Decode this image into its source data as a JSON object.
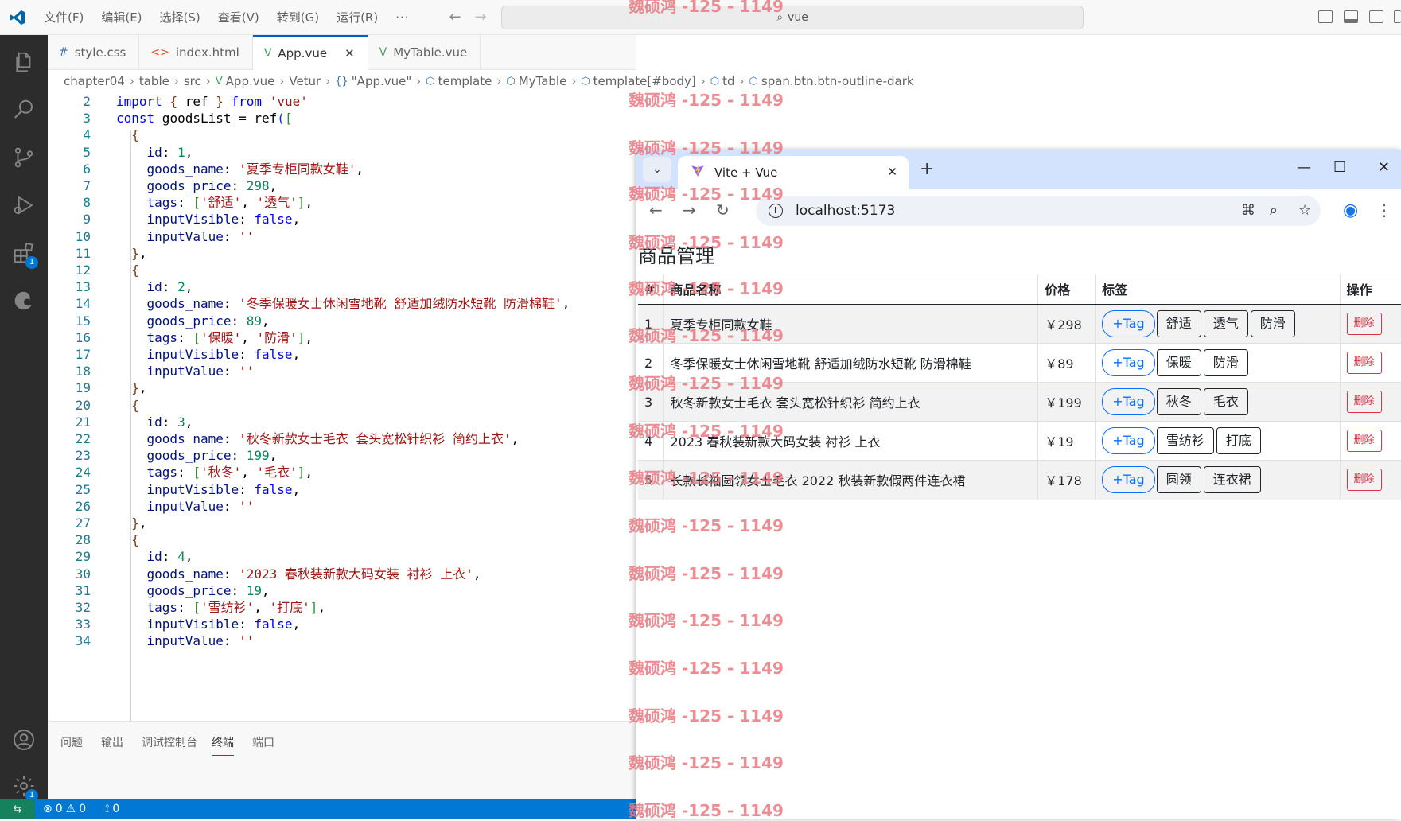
{
  "vscode": {
    "menu": [
      "文件(F)",
      "编辑(E)",
      "选择(S)",
      "查看(V)",
      "转到(G)",
      "运行(R)",
      "···"
    ],
    "search_text": "vue",
    "tabs": [
      {
        "icon": "#",
        "label": "style.css"
      },
      {
        "icon": "<>",
        "label": "index.html"
      },
      {
        "icon": "V",
        "label": "App.vue",
        "active": true
      },
      {
        "icon": "V",
        "label": "MyTable.vue"
      }
    ],
    "breadcrumb": [
      "chapter04",
      "table",
      "src",
      "App.vue",
      "Vetur",
      "\"App.vue\"",
      "template",
      "MyTable",
      "template[#body]",
      "td",
      "span.btn.btn-outline-dark"
    ],
    "code_lines": [
      {
        "n": "2",
        "t": "import { ref } from 'vue'"
      },
      {
        "n": "3",
        "t": "const goodsList = ref(["
      },
      {
        "n": "4",
        "t": "  {"
      },
      {
        "n": "5",
        "t": "    id: 1,"
      },
      {
        "n": "6",
        "t": "    goods_name: '夏季专柜同款女鞋',"
      },
      {
        "n": "7",
        "t": "    goods_price: 298,"
      },
      {
        "n": "8",
        "t": "    tags: ['舒适', '透气'],"
      },
      {
        "n": "9",
        "t": "    inputVisible: false,"
      },
      {
        "n": "10",
        "t": "    inputValue: ''"
      },
      {
        "n": "11",
        "t": "  },"
      },
      {
        "n": "12",
        "t": "  {"
      },
      {
        "n": "13",
        "t": "    id: 2,"
      },
      {
        "n": "14",
        "t": "    goods_name: '冬季保暖女士休闲雪地靴 舒适加绒防水短靴 防滑棉鞋',"
      },
      {
        "n": "15",
        "t": "    goods_price: 89,"
      },
      {
        "n": "16",
        "t": "    tags: ['保暖', '防滑'],"
      },
      {
        "n": "17",
        "t": "    inputVisible: false,"
      },
      {
        "n": "18",
        "t": "    inputValue: ''"
      },
      {
        "n": "19",
        "t": "  },"
      },
      {
        "n": "20",
        "t": "  {"
      },
      {
        "n": "21",
        "t": "    id: 3,"
      },
      {
        "n": "22",
        "t": "    goods_name: '秋冬新款女士毛衣 套头宽松针织衫 简约上衣',"
      },
      {
        "n": "23",
        "t": "    goods_price: 199,"
      },
      {
        "n": "24",
        "t": "    tags: ['秋冬', '毛衣'],"
      },
      {
        "n": "25",
        "t": "    inputVisible: false,"
      },
      {
        "n": "26",
        "t": "    inputValue: ''"
      },
      {
        "n": "27",
        "t": "  },"
      },
      {
        "n": "28",
        "t": "  {"
      },
      {
        "n": "29",
        "t": "    id: 4,"
      },
      {
        "n": "30",
        "t": "    goods_name: '2023 春秋装新款大码女装 衬衫 上衣',"
      },
      {
        "n": "31",
        "t": "    goods_price: 19,"
      },
      {
        "n": "32",
        "t": "    tags: ['雪纺衫', '打底'],"
      },
      {
        "n": "33",
        "t": "    inputVisible: false,"
      },
      {
        "n": "34",
        "t": "    inputValue: ''"
      }
    ],
    "panel_tabs": [
      "问题",
      "输出",
      "调试控制台",
      "终端",
      "端口"
    ],
    "panel_active": "终端",
    "status": {
      "errors": "0",
      "warnings": "0",
      "ports": "0"
    },
    "badges": {
      "extensions": "1",
      "settings": "1"
    }
  },
  "browser": {
    "tab_title": "Vite + Vue",
    "url": "localhost:5173",
    "page_title": "商品管理",
    "table": {
      "headers": [
        "#",
        "商品名称",
        "价格",
        "标签",
        "操作"
      ],
      "add_tag_label": "+Tag",
      "delete_label": "删除",
      "rows": [
        {
          "id": "1",
          "name": "夏季专柜同款女鞋",
          "price": "￥298",
          "tags": [
            "舒适",
            "透气",
            "防滑"
          ]
        },
        {
          "id": "2",
          "name": "冬季保暖女士休闲雪地靴 舒适加绒防水短靴 防滑棉鞋",
          "price": "￥89",
          "tags": [
            "保暖",
            "防滑"
          ]
        },
        {
          "id": "3",
          "name": "秋冬新款女士毛衣 套头宽松针织衫 简约上衣",
          "price": "￥199",
          "tags": [
            "秋冬",
            "毛衣"
          ]
        },
        {
          "id": "4",
          "name": "2023 春秋装新款大码女装 衬衫 上衣",
          "price": "￥19",
          "tags": [
            "雪纺衫",
            "打底"
          ]
        },
        {
          "id": "5",
          "name": "长款长袖圆领女士毛衣 2022 秋装新款假两件连衣裙",
          "price": "￥178",
          "tags": [
            "圆领",
            "连衣裙"
          ]
        }
      ]
    }
  },
  "watermark": "魏硕鸿 -125 - 1149"
}
